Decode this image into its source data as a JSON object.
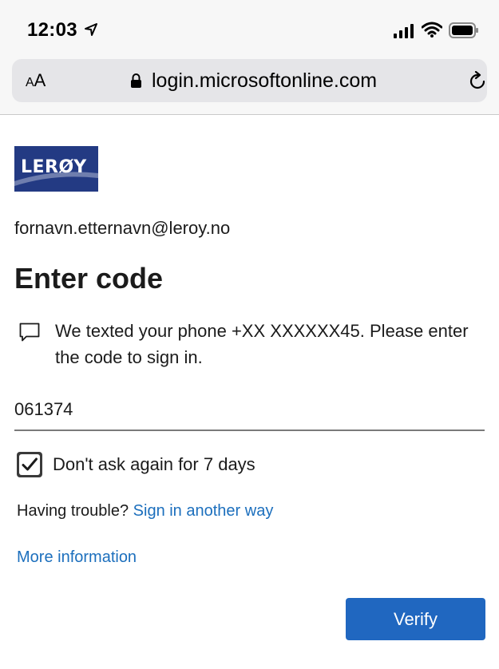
{
  "status_bar": {
    "time": "12:03"
  },
  "browser": {
    "text_size_label_small": "A",
    "text_size_label_large": "A",
    "url": "login.microsoftonline.com"
  },
  "logo": {
    "text": "LERØY"
  },
  "account": {
    "email": "fornavn.etternavn@leroy.no"
  },
  "main": {
    "title": "Enter code",
    "message": "We texted your phone +XX XXXXXX45. Please enter the code to sign in.",
    "code_value": "061374",
    "remember_label": "Don't ask again for 7 days",
    "remember_checked": true,
    "trouble_text": "Having trouble?",
    "sign_in_another_way": "Sign in another way",
    "more_information": "More information",
    "verify_label": "Verify"
  },
  "colors": {
    "brand_blue": "#233a83",
    "link_blue": "#1c6fbd",
    "button_blue": "#2067c0"
  },
  "icons": [
    "location-arrow-icon",
    "signal-icon",
    "wifi-icon",
    "battery-icon",
    "lock-icon",
    "reload-icon",
    "sms-icon",
    "checkmark-icon"
  ]
}
